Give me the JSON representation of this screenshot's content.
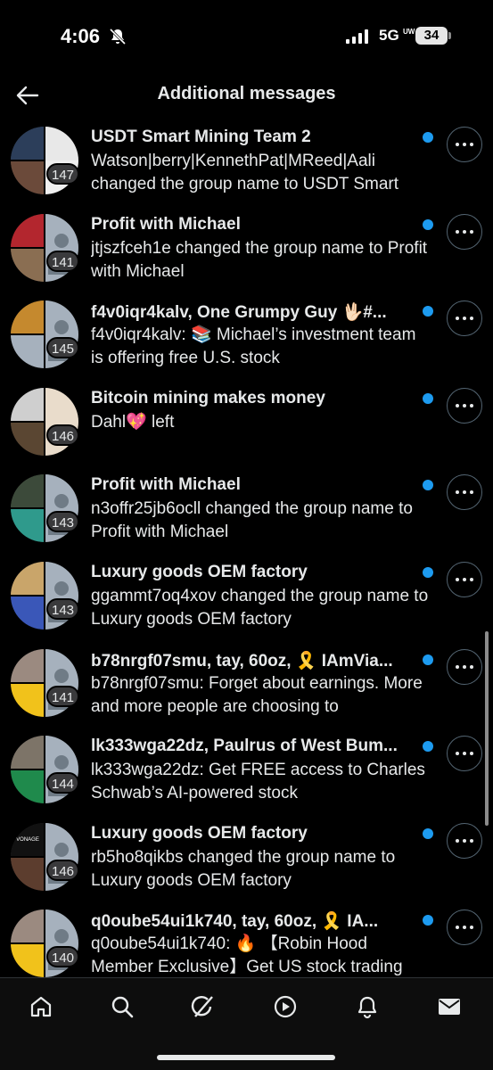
{
  "status_bar": {
    "time": "4:06",
    "network": "5G",
    "network_sub": "UW",
    "battery": "34"
  },
  "header": {
    "title": "Additional messages",
    "back_icon": "arrow-left-icon"
  },
  "colors": {
    "accent": "#1d9bf0",
    "background": "#000000",
    "text": "#e7e9ea"
  },
  "conversations": [
    {
      "title": "USDT Smart Mining Team 2",
      "preview": "Watson|berry|KennethPat|MReed|Aali changed the group name to USDT Smart",
      "count": "147"
    },
    {
      "title": "Profit with Michael",
      "preview": "jtjszfceh1e changed the group name to Profit with Michael",
      "count": "141"
    },
    {
      "title": "f4v0iqr4kalv, One Grumpy Guy 🖖🏻#...",
      "preview": "f4v0iqr4kalv: 📚 Michael’s investment team is offering free U.S. stock",
      "count": "145"
    },
    {
      "title": "Bitcoin mining makes money",
      "preview": "Dahl💖 left",
      "count": "146"
    },
    {
      "title": "Profit with Michael",
      "preview": "n3offr25jb6ocll changed the group name to Profit with Michael",
      "count": "143"
    },
    {
      "title": "Luxury goods OEM factory",
      "preview": "ggammt7oq4xov changed the group name to Luxury goods OEM factory",
      "count": "143"
    },
    {
      "title": "b78nrgf07smu, tay, 60oz, 🎗️ IAmVia...",
      "preview": "b78nrgf07smu: Forget about earnings. More and more people are choosing to",
      "count": "141"
    },
    {
      "title": "lk333wga22dz, Paulrus of West Bum...",
      "preview": "lk333wga22dz: Get FREE access to Charles Schwab’s AI-powered stock",
      "count": "144"
    },
    {
      "title": "Luxury goods OEM factory",
      "preview": "rb5ho8qikbs changed the group name to Luxury goods OEM factory",
      "count": "146"
    },
    {
      "title": "q0oube54ui1k740, tay, 60oz, 🎗️ IA...",
      "preview": "q0oube54ui1k740: 🔥 【Robin Hood Member Exclusive】Get US stock trading",
      "count": "140"
    }
  ],
  "avatar_logo_text": "VONAGE",
  "bottom_nav": [
    {
      "name": "home",
      "icon": "home-icon"
    },
    {
      "name": "search",
      "icon": "search-icon"
    },
    {
      "name": "grok",
      "icon": "grok-icon"
    },
    {
      "name": "video",
      "icon": "play-icon"
    },
    {
      "name": "notifications",
      "icon": "bell-icon"
    },
    {
      "name": "messages",
      "icon": "mail-icon"
    }
  ]
}
